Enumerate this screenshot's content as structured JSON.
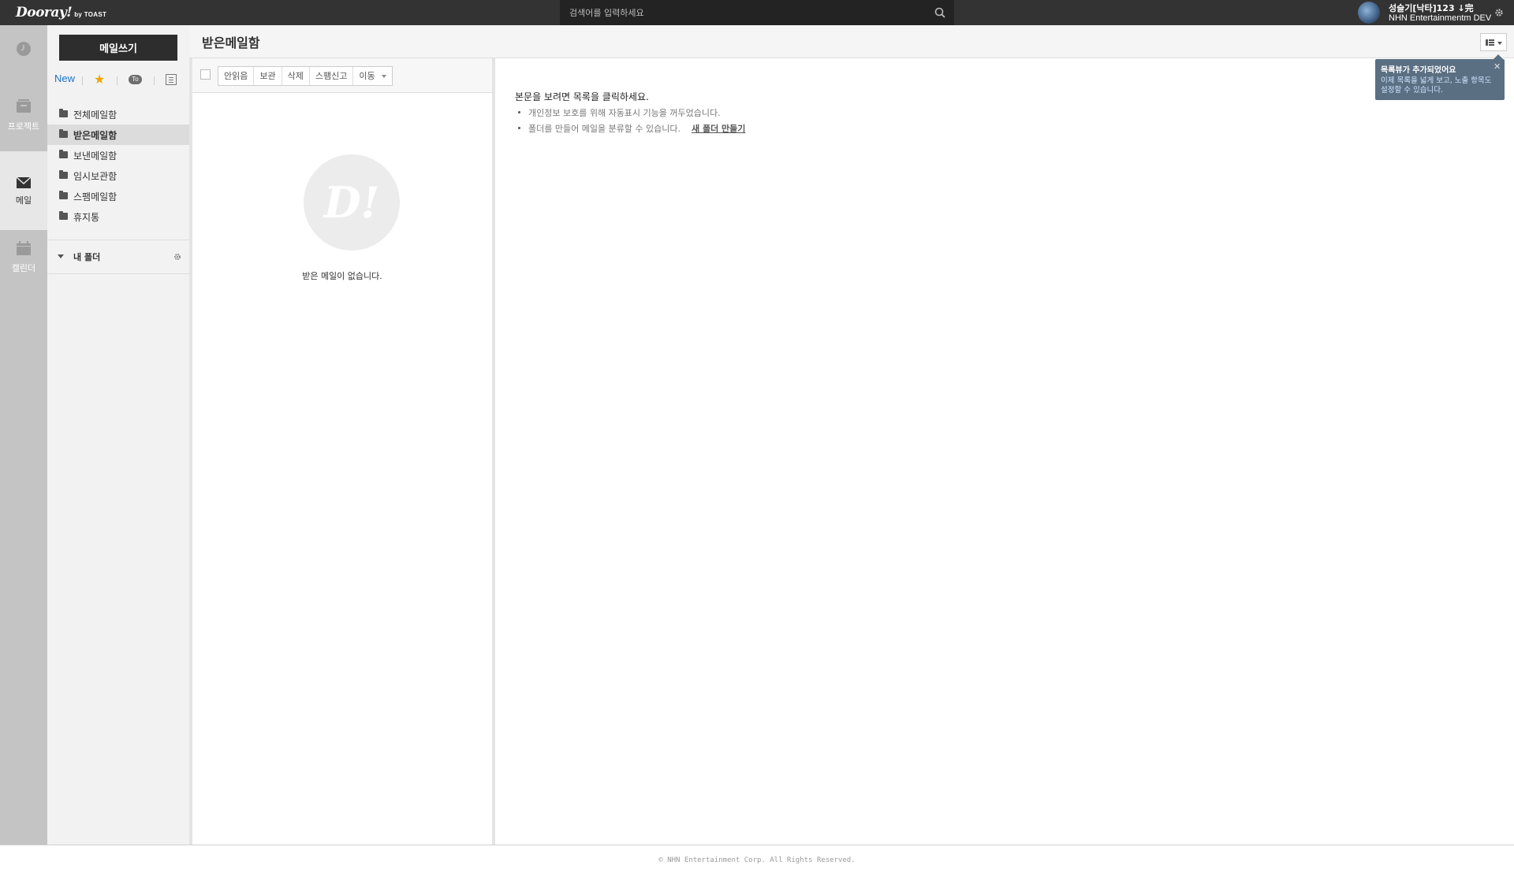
{
  "header": {
    "logo_main": "Dooray!",
    "logo_sub": "by TOAST",
    "search_placeholder": "검색어를 입력하세요",
    "user_name": "성슬기[낙타]123 ↓完",
    "user_org": "NHN Entertainmentm DEV"
  },
  "rail": {
    "items": [
      {
        "label": "",
        "icon": "clock-icon"
      },
      {
        "label": "프로젝트",
        "icon": "project-icon"
      },
      {
        "label": "메일",
        "icon": "mail-icon"
      },
      {
        "label": "캘린더",
        "icon": "calendar-icon"
      }
    ]
  },
  "sidebar": {
    "compose_label": "메일쓰기",
    "filter_new": "New",
    "filter_to": "To",
    "folders": [
      {
        "label": "전체메일함"
      },
      {
        "label": "받은메일함"
      },
      {
        "label": "보낸메일함"
      },
      {
        "label": "임시보관함"
      },
      {
        "label": "스팸메일함"
      },
      {
        "label": "휴지통"
      }
    ],
    "my_folder_label": "내 폴더"
  },
  "main": {
    "title": "받은메일함",
    "toolbar": [
      "안읽음",
      "보관",
      "삭제",
      "스팸신고",
      "이동"
    ],
    "empty_text": "받은 메일이 없습니다.",
    "empty_logo": "D!"
  },
  "reading": {
    "title": "본문을 보려면 목록을 클릭하세요.",
    "bullet1": "개인정보 보호를 위해 자동표시 기능을 꺼두었습니다.",
    "bullet2": "폴더를 만들어 메일을 분류할 수 있습니다.",
    "link": "새 폴더 만들기"
  },
  "tooltip": {
    "title": "목록뷰가 추가되었어요",
    "close": "✕",
    "body": "이제 목록을 넓게 보고, 노출 항목도 설정할 수 있습니다."
  },
  "footer": {
    "text": "© NHN Entertainment Corp. All Rights Reserved."
  },
  "colors": {
    "topbar": "#333333",
    "rail": "#c4c4c4",
    "tooltip": "#5b6f82",
    "link": "#1a73c8",
    "star": "#f0a500"
  }
}
